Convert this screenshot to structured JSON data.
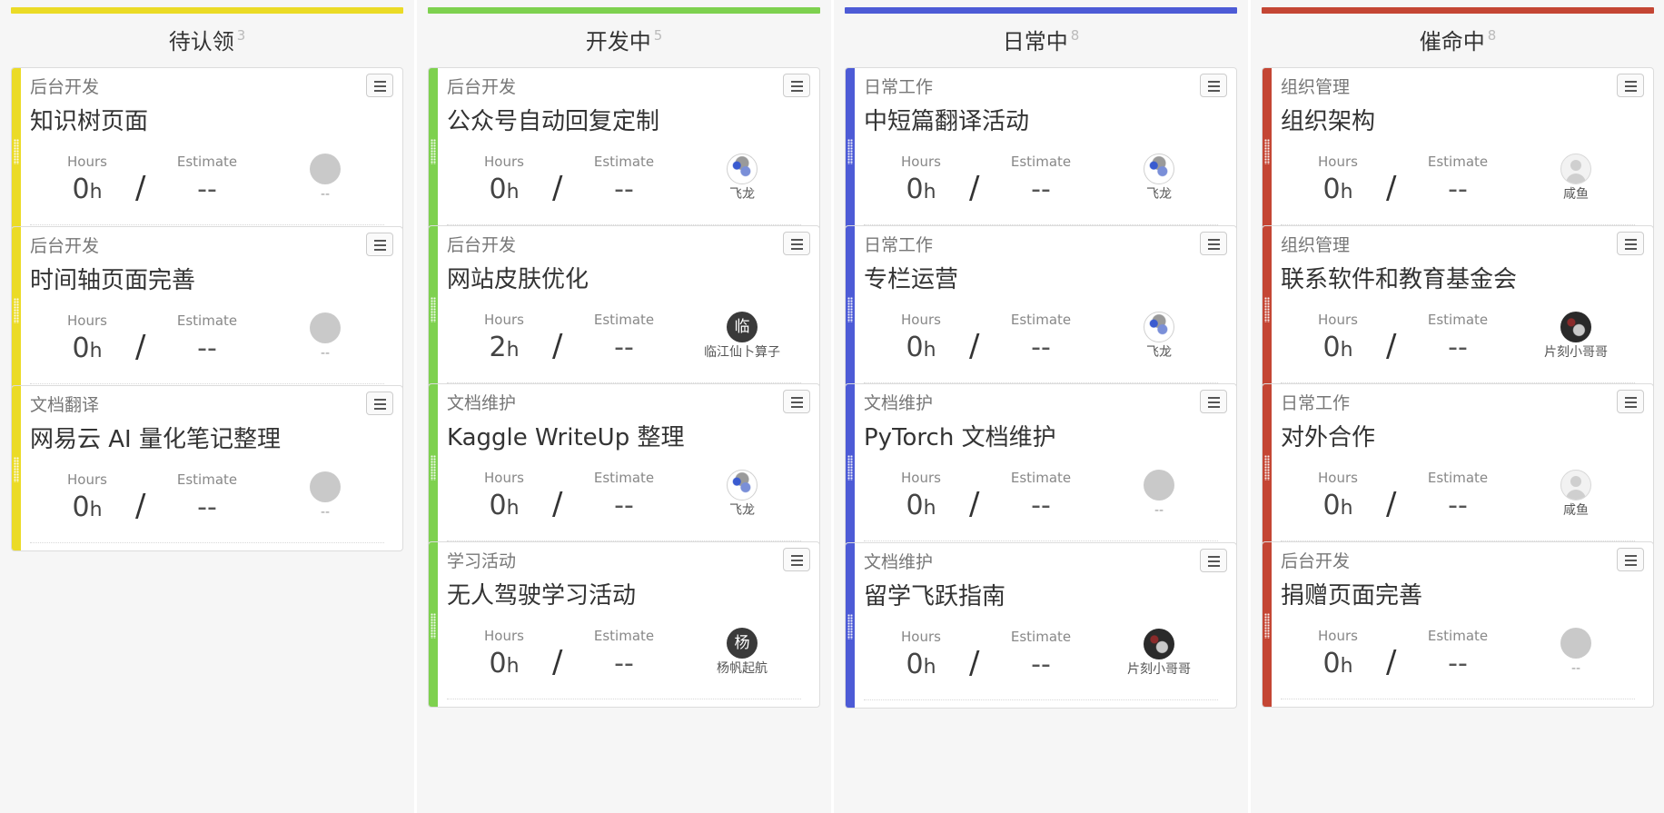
{
  "colors": {
    "yellow": "#ebdb26",
    "green": "#7ed14f",
    "blue": "#4d5bd6",
    "red": "#c44634"
  },
  "labels": {
    "hours": "Hours",
    "estimate": "Estimate",
    "hours_unit": "h",
    "slash": "/"
  },
  "columns": [
    {
      "title": "待认领",
      "count": "3",
      "cards": [
        {
          "tag": "后台开发",
          "title": "知识树页面",
          "hours": "0",
          "estimate": "--",
          "assignee": "--",
          "avatar": "blank-avatar"
        },
        {
          "tag": "后台开发",
          "title": "时间轴页面完善",
          "hours": "0",
          "estimate": "--",
          "assignee": "--",
          "avatar": "blank-avatar"
        },
        {
          "tag": "文档翻译",
          "title": "网易云 AI 量化笔记整理",
          "hours": "0",
          "estimate": "--",
          "assignee": "--",
          "avatar": "blank-avatar"
        }
      ]
    },
    {
      "title": "开发中",
      "count": "5",
      "cards": [
        {
          "tag": "后台开发",
          "title": "公众号自动回复定制",
          "hours": "0",
          "estimate": "--",
          "assignee": "飞龙",
          "avatar": "dragon-avatar"
        },
        {
          "tag": "后台开发",
          "title": "网站皮肤优化",
          "hours": "2",
          "estimate": "--",
          "assignee": "临江仙卜算子",
          "avatar": "initial-avatar",
          "avatar_text": "临"
        },
        {
          "tag": "文档维护",
          "title": "Kaggle WriteUp 整理",
          "hours": "0",
          "estimate": "--",
          "assignee": "飞龙",
          "avatar": "dragon-avatar"
        },
        {
          "tag": "学习活动",
          "title": "无人驾驶学习活动",
          "hours": "0",
          "estimate": "--",
          "assignee": "杨帆起航",
          "avatar": "initial-avatar",
          "avatar_text": "杨"
        }
      ]
    },
    {
      "title": "日常中",
      "count": "8",
      "cards": [
        {
          "tag": "日常工作",
          "title": "中短篇翻译活动",
          "hours": "0",
          "estimate": "--",
          "assignee": "飞龙",
          "avatar": "dragon-avatar"
        },
        {
          "tag": "日常工作",
          "title": "专栏运营",
          "hours": "0",
          "estimate": "--",
          "assignee": "飞龙",
          "avatar": "dragon-avatar"
        },
        {
          "tag": "文档维护",
          "title": "PyTorch 文档维护",
          "hours": "0",
          "estimate": "--",
          "assignee": "--",
          "avatar": "blank-avatar"
        },
        {
          "tag": "文档维护",
          "title": "留学飞跃指南",
          "hours": "0",
          "estimate": "--",
          "assignee": "片刻小哥哥",
          "avatar": "photo-avatar"
        }
      ]
    },
    {
      "title": "催命中",
      "count": "8",
      "cards": [
        {
          "tag": "组织管理",
          "title": "组织架构",
          "hours": "0",
          "estimate": "--",
          "assignee": "咸鱼",
          "avatar": "person-avatar"
        },
        {
          "tag": "组织管理",
          "title": "联系软件和教育基金会",
          "hours": "0",
          "estimate": "--",
          "assignee": "片刻小哥哥",
          "avatar": "photo-avatar"
        },
        {
          "tag": "日常工作",
          "title": "对外合作",
          "hours": "0",
          "estimate": "--",
          "assignee": "咸鱼",
          "avatar": "person-avatar"
        },
        {
          "tag": "后台开发",
          "title": "捐赠页面完善",
          "hours": "0",
          "estimate": "--",
          "assignee": "--",
          "avatar": "blank-avatar"
        }
      ]
    }
  ]
}
